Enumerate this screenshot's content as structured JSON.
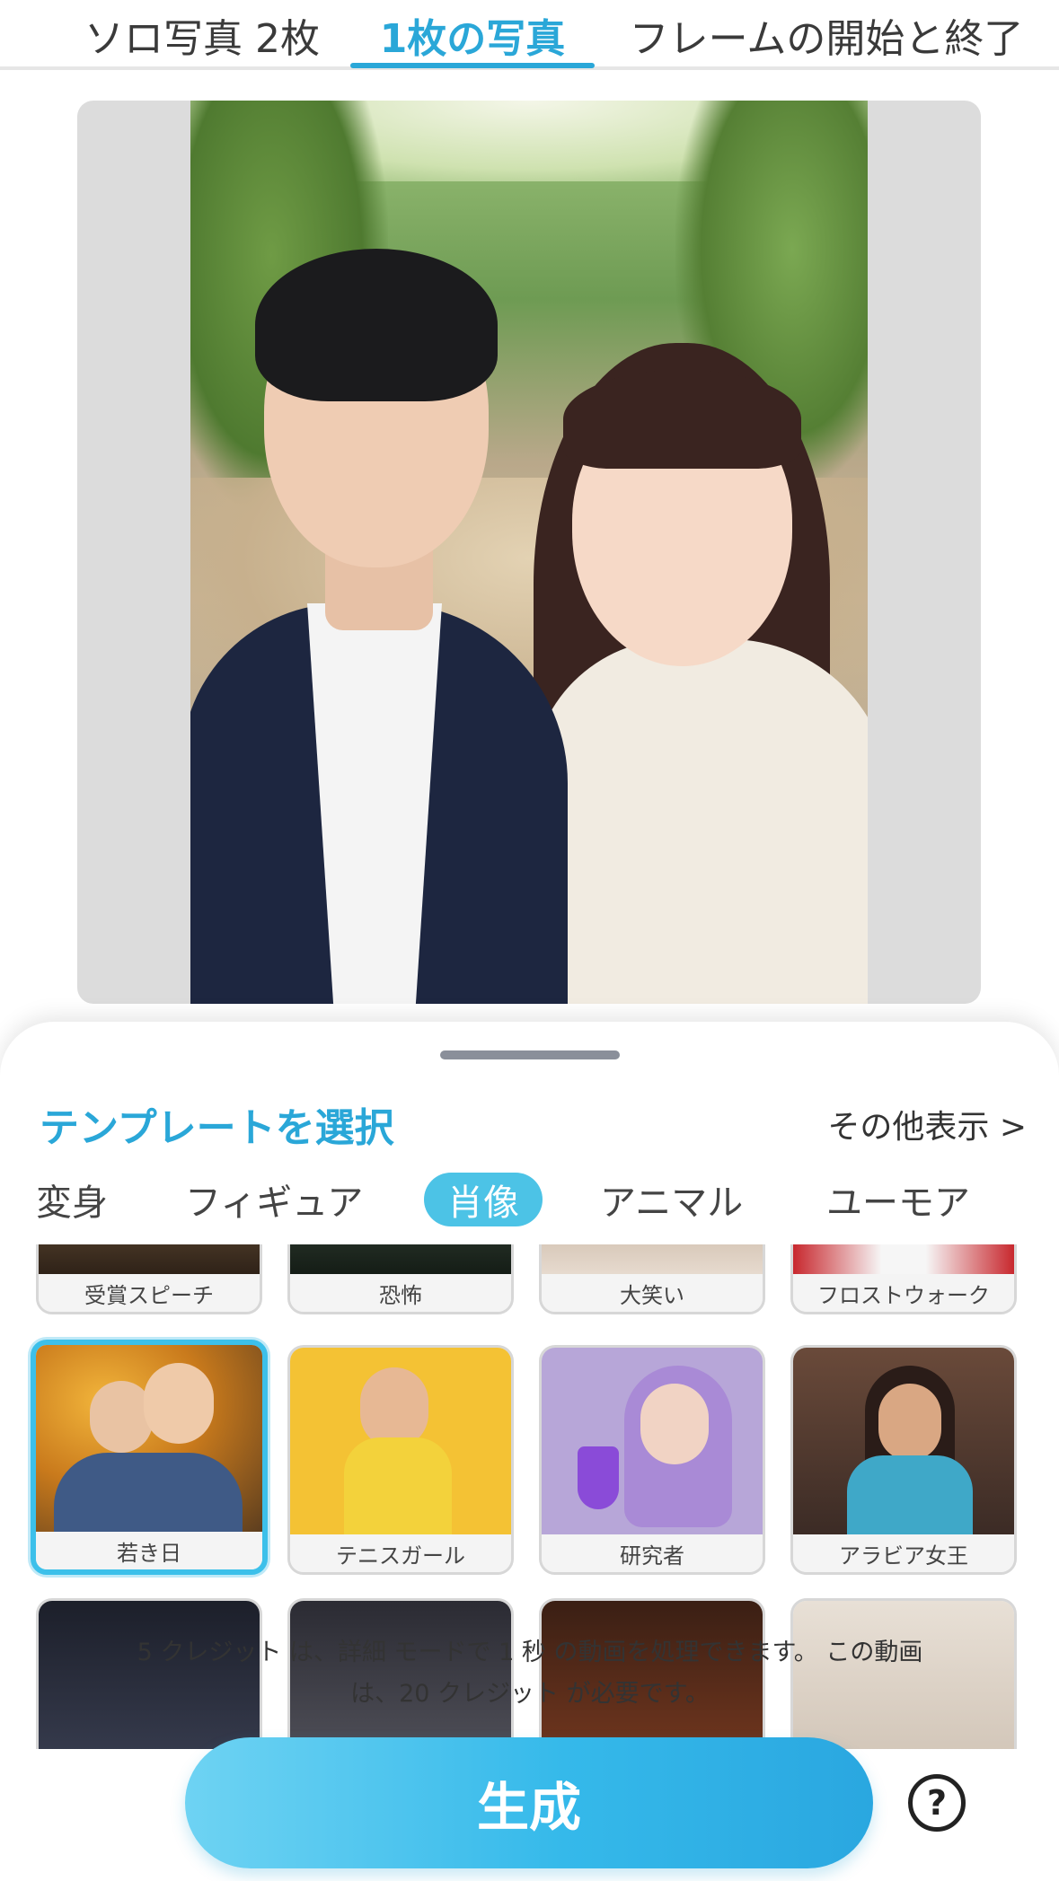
{
  "top_tabs": [
    {
      "label": "ソロ写真 2枚"
    },
    {
      "label": "1枚の写真"
    },
    {
      "label": "フレームの開始と終了"
    }
  ],
  "active_top_tab": "1枚の写真",
  "preview": {
    "icons": {
      "gallery": "gallery-image-icon"
    }
  },
  "sheet": {
    "title": "テンプレートを選択",
    "show_more": "その他表示 >"
  },
  "categories": [
    {
      "label": "変身"
    },
    {
      "label": "フィギュア"
    },
    {
      "label": "肖像"
    },
    {
      "label": "アニマル"
    },
    {
      "label": "ユーモア"
    }
  ],
  "active_category": "肖像",
  "templates_row1": [
    {
      "label": "受賞スピーチ"
    },
    {
      "label": "恐怖"
    },
    {
      "label": "大笑い"
    },
    {
      "label": "フロストウォーク"
    }
  ],
  "templates_row2": [
    {
      "label": "若き日"
    },
    {
      "label": "テニスガール"
    },
    {
      "label": "研究者"
    },
    {
      "label": "アラビア女王"
    }
  ],
  "selected_template": "若き日",
  "footer": {
    "line1": "5 クレジット は、詳細 モードで 1 秒 の動画を処理できます。 この動画",
    "line2": "は、20 クレジット が必要です。"
  },
  "generate_label": "生成",
  "help_label": "?",
  "colors": {
    "accent": "#2aa7d8",
    "selected_border": "#3cc0ea",
    "button_gradient_start": "#6ed3f3",
    "button_gradient_end": "#2aa7e0"
  }
}
